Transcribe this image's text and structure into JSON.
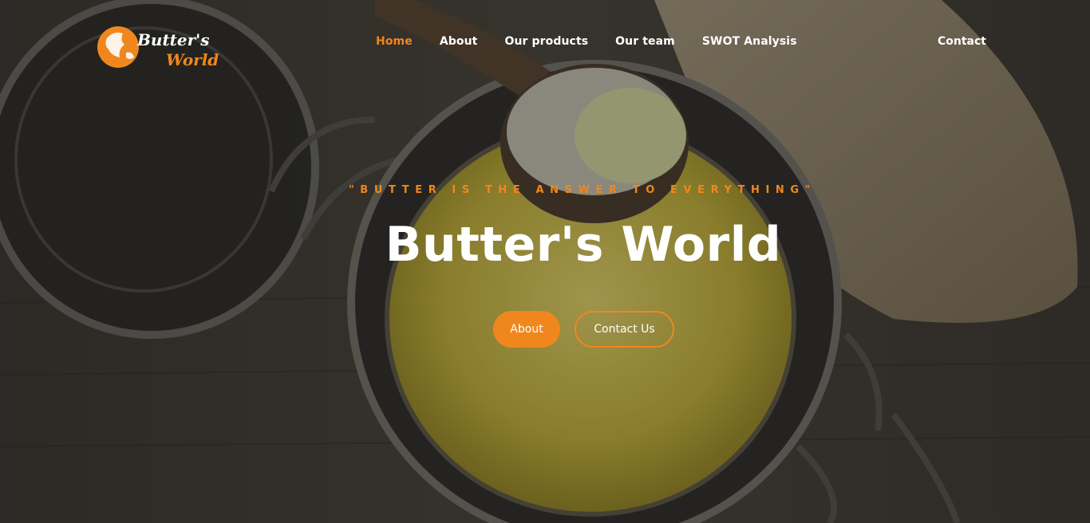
{
  "logo": {
    "line1": "Butter's",
    "line2": "World"
  },
  "nav": {
    "items": [
      {
        "label": "Home",
        "active": true
      },
      {
        "label": "About",
        "active": false
      },
      {
        "label": "Our products",
        "active": false
      },
      {
        "label": "Our team",
        "active": false
      },
      {
        "label": "SWOT Analysis",
        "active": false
      }
    ],
    "contact": "Contact"
  },
  "hero": {
    "tagline": "\"BUTTER IS THE ANSWER TO EVERYTHING\"",
    "title": "Butter's World",
    "btn_about": "About",
    "btn_contact": "Contact Us"
  },
  "colors": {
    "accent": "#f0871d",
    "text": "#ffffff"
  }
}
